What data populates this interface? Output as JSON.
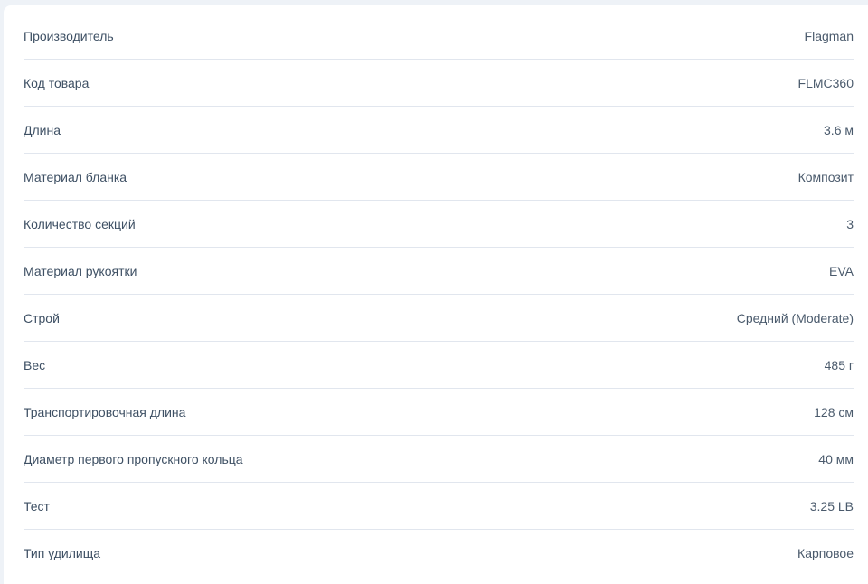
{
  "specs": [
    {
      "label": "Производитель",
      "value": "Flagman"
    },
    {
      "label": "Код товара",
      "value": "FLMC360"
    },
    {
      "label": "Длина",
      "value": "3.6 м"
    },
    {
      "label": "Материал бланка",
      "value": "Композит"
    },
    {
      "label": "Количество секций",
      "value": "3"
    },
    {
      "label": "Материал рукоятки",
      "value": "EVA"
    },
    {
      "label": "Строй",
      "value": "Средний (Moderate)"
    },
    {
      "label": "Вес",
      "value": "485 г"
    },
    {
      "label": "Транспортировочная длина",
      "value": "128 см"
    },
    {
      "label": "Диаметр первого пропускного кольца",
      "value": "40 мм"
    },
    {
      "label": "Тест",
      "value": "3.25 LB"
    },
    {
      "label": "Тип удилища",
      "value": "Карповое"
    }
  ]
}
